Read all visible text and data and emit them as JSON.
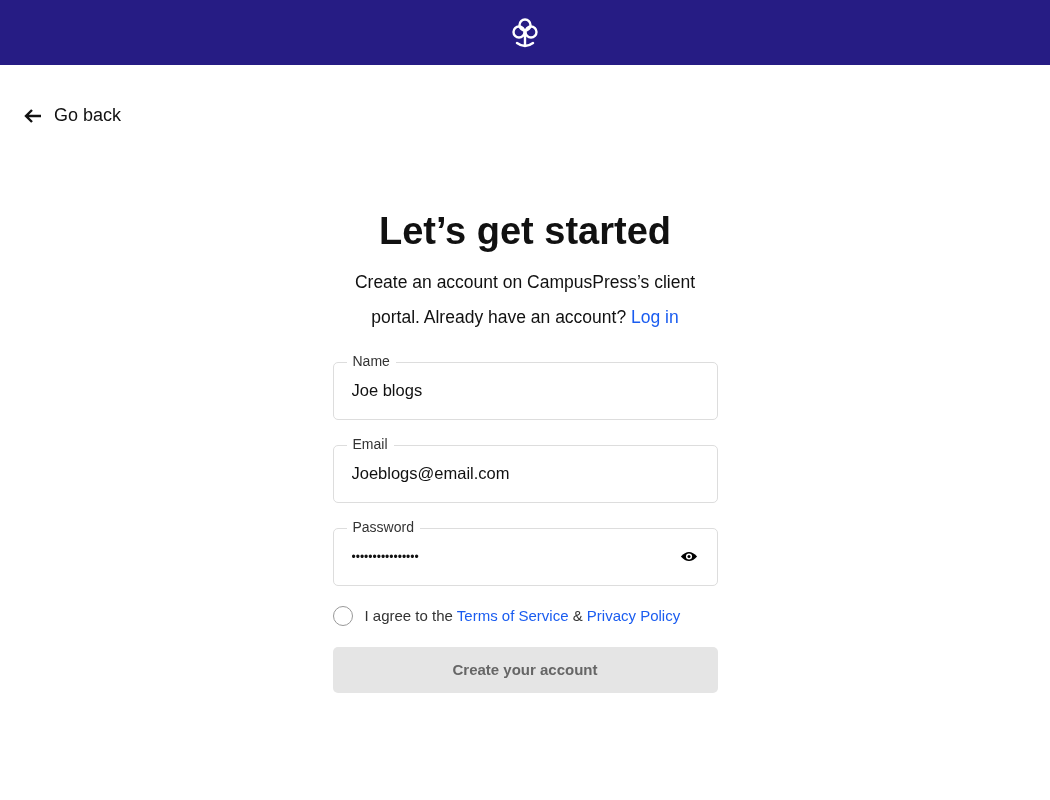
{
  "back_link": {
    "label": "Go back"
  },
  "title": "Let’s get started",
  "intro": {
    "text": "Create an account on CampusPress’s client portal. Already have an account?",
    "link": "Log in"
  },
  "fields": [
    {
      "kind": "text",
      "label": "Name",
      "value": "Joe blogs"
    },
    {
      "kind": "text",
      "label": "Email",
      "value": "Joeblogs@email.com"
    },
    {
      "kind": "password",
      "label": "Password",
      "value": "••••••••••••••••"
    }
  ],
  "agreement": {
    "checked": false,
    "prefix": "I agree to the",
    "terms_link": "Terms of Service",
    "joiner": "&",
    "privacy_link": "Privacy Policy"
  },
  "submit": {
    "label": "Create your account",
    "disabled": true
  }
}
